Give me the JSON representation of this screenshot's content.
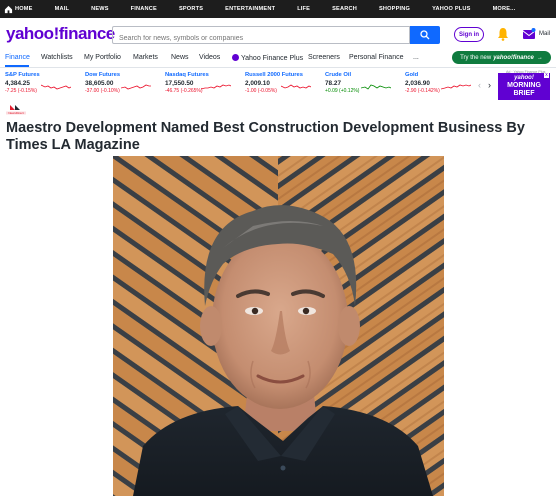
{
  "topbar": {
    "items": [
      "HOME",
      "MAIL",
      "NEWS",
      "FINANCE",
      "SPORTS",
      "ENTERTAINMENT",
      "LIFE",
      "SEARCH",
      "SHOPPING",
      "YAHOO PLUS",
      "MORE..."
    ]
  },
  "header": {
    "logo_main": "yahoo",
    "logo_slash": "!",
    "logo_sub": "finance",
    "search_placeholder": "Search for news, symbols or companies",
    "signin_label": "Sign in",
    "mail_label": "Mail"
  },
  "nav": {
    "items": [
      "Finance",
      "Watchlists",
      "My Portfolio",
      "Markets",
      "News",
      "Videos",
      "Yahoo Finance Plus",
      "Screeners",
      "Personal Finance",
      "..."
    ],
    "try_label": "Try the new",
    "try_brand": "yahoo!finance",
    "try_arrow": "→"
  },
  "tickers": [
    {
      "name": "S&P Futures",
      "price": "4,384.25",
      "change": "-7.25 (-0.15%)",
      "direction": "down"
    },
    {
      "name": "Dow Futures",
      "price": "38,605.00",
      "change": "-37.00 (-0.10%)",
      "direction": "down"
    },
    {
      "name": "Nasdaq Futures",
      "price": "17,550.50",
      "change": "-46.75 (-0.265%)",
      "direction": "down"
    },
    {
      "name": "Russell 2000 Futures",
      "price": "2,009.10",
      "change": "-1.00 (-0.05%)",
      "direction": "down"
    },
    {
      "name": "Crude Oil",
      "price": "78.27",
      "change": "+0.09 (+0.12%)",
      "direction": "up"
    },
    {
      "name": "Gold",
      "price": "2,036.90",
      "change": "-2.90 (-0.142%)",
      "direction": "down"
    }
  ],
  "ad": {
    "label": "Ad · Yahoo Finance Plus",
    "brand": "yahoo!",
    "line1": "MORNING",
    "line2": "BRIEF",
    "close": "x"
  },
  "colors": {
    "brand": "#6001d2",
    "accent": "#0f69ff",
    "down": "#eb0f29",
    "up": "#008a00",
    "try_bg": "#0f7b3f"
  },
  "article": {
    "source_logo_label": "NewsDirect",
    "headline": "Maestro Development Named Best Construction Development Business By Times LA Magazine"
  }
}
